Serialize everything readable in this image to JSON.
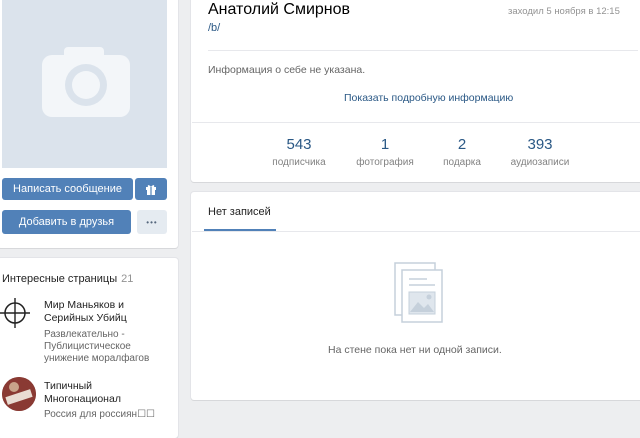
{
  "profile": {
    "name": "Анатолий Смирнов",
    "status": "/b/",
    "last_seen": "заходил 5 ноября в 12:15",
    "about": "Информация о себе не указана.",
    "show_more": "Показать подробную информацию"
  },
  "actions": {
    "message": "Написать сообщение",
    "gift_icon": "gift-icon",
    "add_friend": "Добавить в друзья",
    "more": "•••"
  },
  "stats": [
    {
      "num": "543",
      "label": "подписчика"
    },
    {
      "num": "1",
      "label": "фотография"
    },
    {
      "num": "2",
      "label": "подарка"
    },
    {
      "num": "393",
      "label": "аудиозаписи"
    }
  ],
  "pages": {
    "title": "Интересные страницы",
    "count": "21",
    "items": [
      {
        "name_line1": "Мир Маньяков и",
        "name_line2": "Серийных Убийц",
        "desc_line1": "Развлекательно -",
        "desc_line2": "Публицистическое",
        "desc_line3": "унижение моралфагов",
        "icon": "crosshair-icon"
      },
      {
        "name_line1": "Типичный",
        "name_line2": "Многонационал",
        "desc_line1": "Россия для россиян☐☐",
        "icon": "community-avatar"
      }
    ]
  },
  "wall": {
    "tab": "Нет записей",
    "empty": "На стене пока нет ни одной записи."
  },
  "colors": {
    "accent": "#5181b8",
    "link": "#2a5885",
    "background": "#edeef0"
  }
}
